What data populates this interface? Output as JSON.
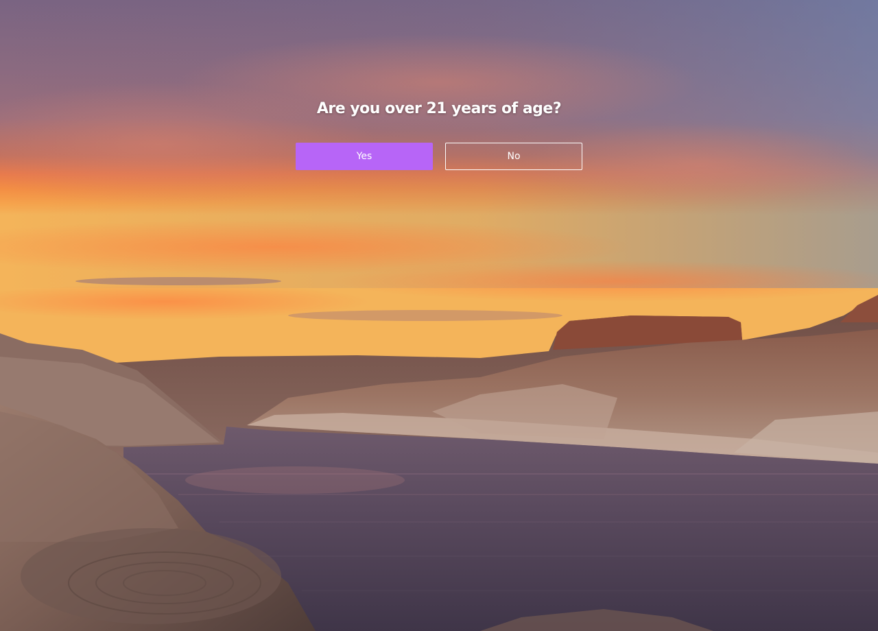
{
  "age_gate": {
    "question": "Are you over 21 years of age?",
    "yes_label": "Yes",
    "no_label": "No"
  },
  "colors": {
    "accent": "#b765f7",
    "text": "#ffffff"
  }
}
